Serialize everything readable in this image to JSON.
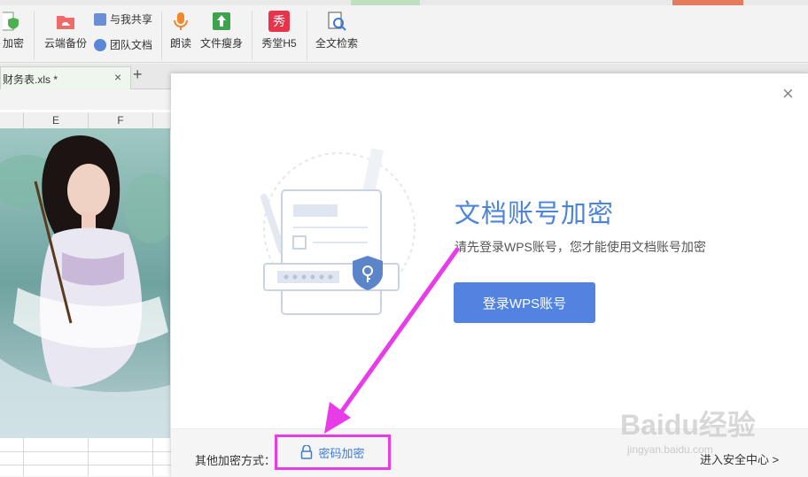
{
  "ribbon": {
    "encrypt_label": "加密",
    "cloud_backup_label": "云端备份",
    "share_label": "与我共享",
    "team_docs_label": "团队文档",
    "read_aloud_label": "朗读",
    "slim_label": "文件瘦身",
    "h5_label": "秀堂H5",
    "h5_icon_text": "秀",
    "search_label": "全文检索"
  },
  "tabs": {
    "file_name": "财务表.xls *",
    "close": "×",
    "add": "+"
  },
  "sheet": {
    "columns": [
      "E",
      "F"
    ]
  },
  "dialog": {
    "close": "×",
    "title": "文档账号加密",
    "subtitle": "请先登录WPS账号，您才能使用文档账号加密",
    "login_button": "登录WPS账号",
    "other_methods_label": "其他加密方式：",
    "password_encrypt_label": "密码加密",
    "security_center_link": "进入安全中心 >"
  },
  "watermark": {
    "logo": "Baidu经验",
    "url": "jingyan.baidu.com"
  },
  "colors": {
    "accent_blue": "#5283e0",
    "title_blue": "#4b84d8",
    "highlight_magenta": "#e93ce9"
  }
}
